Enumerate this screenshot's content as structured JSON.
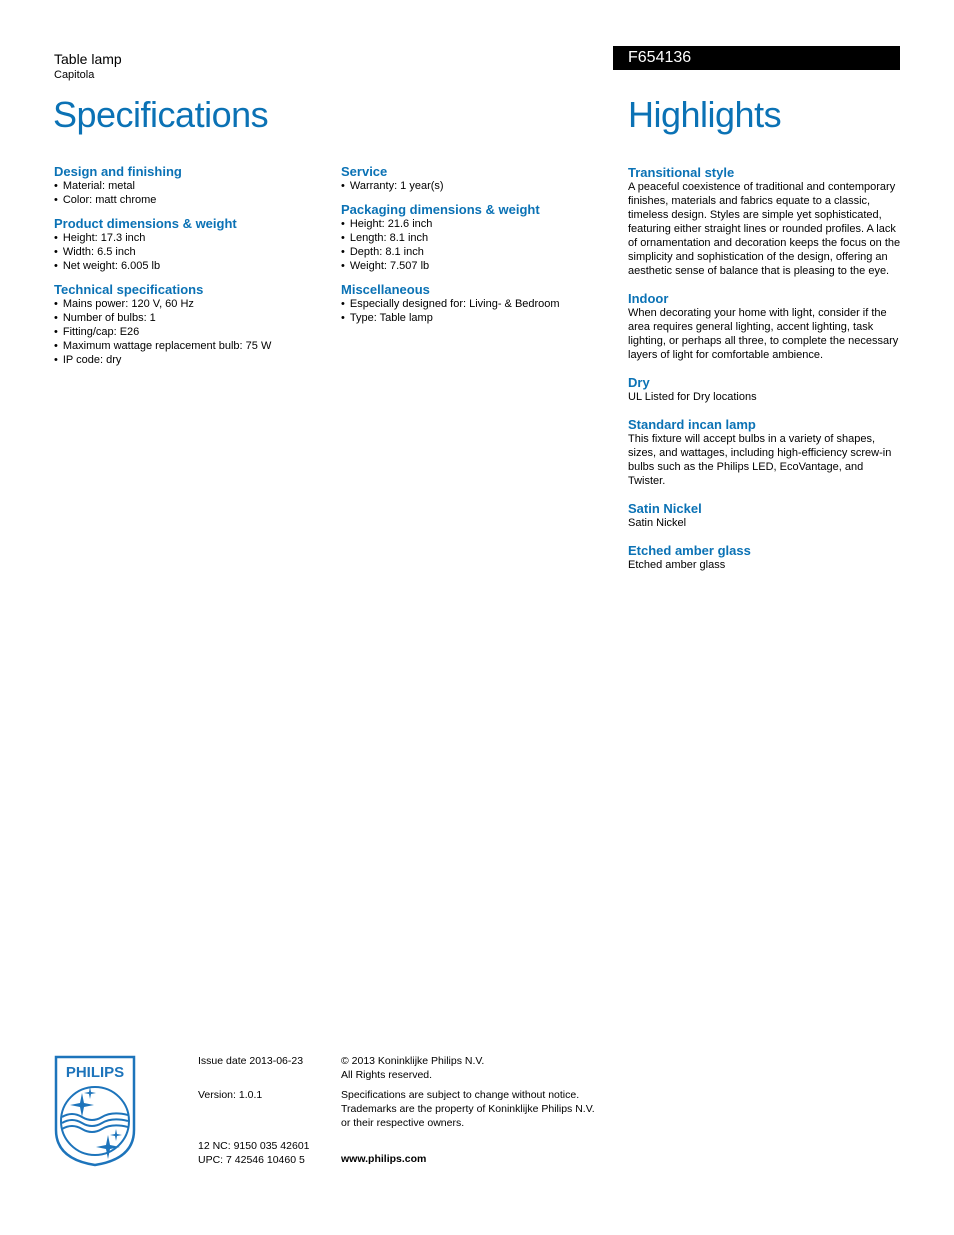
{
  "header": {
    "product_type": "Table lamp",
    "product_name": "Capitola",
    "model": "F654136",
    "spec_title": "Specifications",
    "highlights_title": "Highlights"
  },
  "colors": {
    "accent": "#0b72b5",
    "model_bar": "#000000"
  },
  "specs_left": [
    {
      "heading": "Design and finishing",
      "items": [
        "Material: metal",
        "Color: matt chrome"
      ]
    },
    {
      "heading": "Product dimensions & weight",
      "items": [
        "Height: 17.3 inch",
        "Width: 6.5 inch",
        "Net weight: 6.005 lb"
      ]
    },
    {
      "heading": "Technical specifications",
      "items": [
        "Mains power: 120 V, 60 Hz",
        "Number of bulbs: 1",
        "Fitting/cap: E26",
        "Maximum wattage replacement bulb: 75 W",
        "IP code: dry"
      ]
    }
  ],
  "specs_right": [
    {
      "heading": "Service",
      "items": [
        "Warranty: 1 year(s)"
      ]
    },
    {
      "heading": "Packaging dimensions & weight",
      "items": [
        "Height: 21.6 inch",
        "Length: 8.1 inch",
        "Depth: 8.1 inch",
        "Weight: 7.507 lb"
      ]
    },
    {
      "heading": "Miscellaneous",
      "items": [
        "Especially designed for: Living- & Bedroom",
        "Type: Table lamp"
      ]
    }
  ],
  "highlights": [
    {
      "heading": "Transitional style",
      "text": "A peaceful coexistence of traditional and contemporary finishes, materials and fabrics equate to a classic, timeless design. Styles are simple yet sophisticated, featuring either straight lines or rounded profiles. A lack of ornamentation and decoration keeps the focus on the simplicity and sophistication of the design, offering an aesthetic sense of balance that is pleasing to the eye."
    },
    {
      "heading": "Indoor",
      "text": "When decorating your home with light, consider if the area requires general lighting, accent lighting, task lighting, or perhaps all three, to complete the necessary layers of light for comfortable ambience."
    },
    {
      "heading": "Dry",
      "text": "UL Listed for Dry locations"
    },
    {
      "heading": "Standard incan lamp",
      "text": "This fixture will accept bulbs in a variety of shapes, sizes, and wattages, including high-efficiency screw-in bulbs such as the Philips LED, EcoVantage, and Twister."
    },
    {
      "heading": "Satin Nickel",
      "text": "Satin Nickel"
    },
    {
      "heading": "Etched amber glass",
      "text": "Etched amber glass"
    }
  ],
  "footer": {
    "logo_text": "PHILIPS",
    "issue_date": "Issue date 2013-06-23",
    "version": "Version: 1.0.1",
    "nc": "12 NC: 9150 035 42601",
    "upc": "UPC: 7 42546 10460 5",
    "copyright": "© 2013 Koninklijke Philips N.V.",
    "rights": "All Rights reserved.",
    "disclaimer_1": "Specifications are subject to change without notice.",
    "disclaimer_2": "Trademarks are the property of Koninklijke Philips N.V.",
    "disclaimer_3": "or their respective owners.",
    "website": "www.philips.com"
  }
}
